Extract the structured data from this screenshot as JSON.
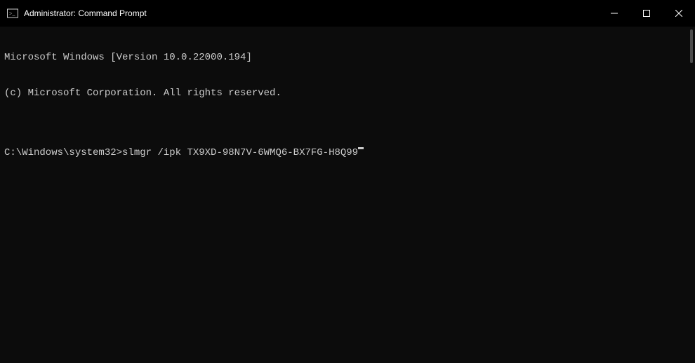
{
  "titlebar": {
    "title": "Administrator: Command Prompt"
  },
  "terminal": {
    "line1": "Microsoft Windows [Version 10.0.22000.194]",
    "line2": "(c) Microsoft Corporation. All rights reserved.",
    "blank": "",
    "prompt": "C:\\Windows\\system32>",
    "command": "slmgr /ipk TX9XD-98N7V-6WMQ6-BX7FG-H8Q99"
  }
}
